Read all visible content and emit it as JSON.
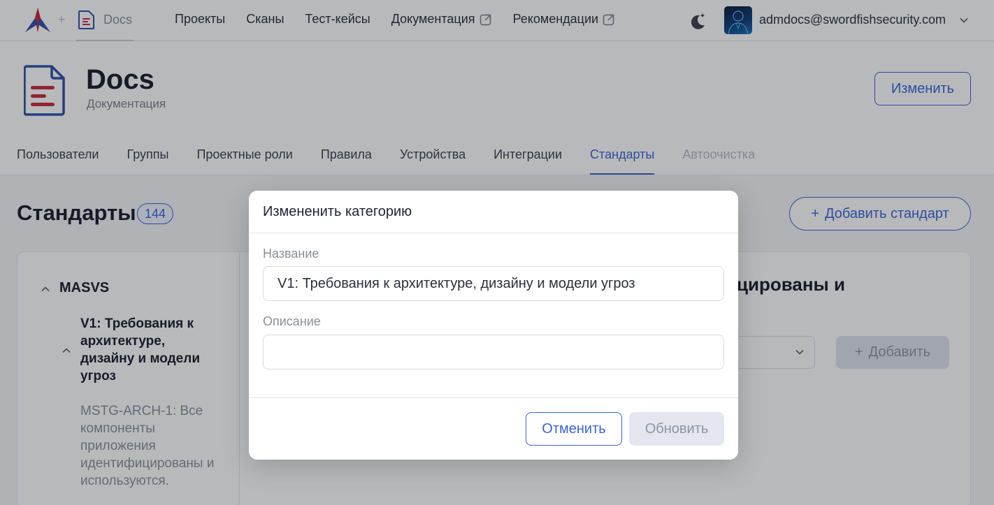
{
  "topbar": {
    "logo_icon": "swordfish-logo",
    "separator": "+",
    "project_icon": "document-icon",
    "project_name": "Docs",
    "nav": [
      {
        "label": "Проекты",
        "external": false
      },
      {
        "label": "Сканы",
        "external": false
      },
      {
        "label": "Тест-кейсы",
        "external": false
      },
      {
        "label": "Документация",
        "external": true
      },
      {
        "label": "Рекомендации",
        "external": true
      }
    ],
    "theme_icon": "moon-icon",
    "user_email": "admdocs@swordfishsecurity.com"
  },
  "header": {
    "title": "Docs",
    "subtitle": "Документация",
    "edit_label": "Изменить"
  },
  "tabs": [
    {
      "label": "Пользователи",
      "state": "normal"
    },
    {
      "label": "Группы",
      "state": "normal"
    },
    {
      "label": "Проектные роли",
      "state": "normal"
    },
    {
      "label": "Правила",
      "state": "normal"
    },
    {
      "label": "Устройства",
      "state": "normal"
    },
    {
      "label": "Интеграции",
      "state": "normal"
    },
    {
      "label": "Стандарты",
      "state": "active"
    },
    {
      "label": "Автоочистка",
      "state": "disabled"
    }
  ],
  "standards": {
    "title": "Стандарты",
    "count": "144",
    "add_label": "Добавить стандарт",
    "tree": {
      "root": "MASVS",
      "category": "V1: Требования к архитектуре, дизайну и модели угроз",
      "requirement": "MSTG-ARCH-1: Все компоненты приложения идентифицированы и используются."
    },
    "right_heading": "ицированы и",
    "right_add_label": "Добавить"
  },
  "modal": {
    "title": "Измененить категорию",
    "name_label": "Название",
    "name_value": "V1: Требования к архитектуре, дизайну и модели угроз",
    "description_label": "Описание",
    "description_value": "",
    "cancel_label": "Отменить",
    "update_label": "Обновить"
  },
  "colors": {
    "accent": "#3a63d6",
    "logo_red": "#c8283c",
    "logo_blue": "#2f4fa8",
    "overlay": "rgba(20,22,30,0.30)"
  }
}
